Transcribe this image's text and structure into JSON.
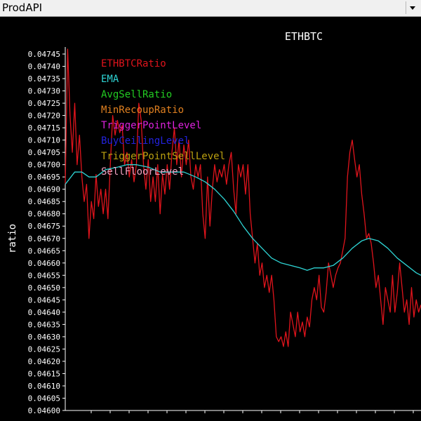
{
  "window": {
    "title": "ProdAPI"
  },
  "chart_data": {
    "type": "line",
    "title": "ETHBTC",
    "xlabel": "",
    "ylabel": "ratio",
    "ylim": [
      0.046,
      0.04745
    ],
    "y_ticks": [
      "0.04600",
      "0.04605",
      "0.04610",
      "0.04615",
      "0.04620",
      "0.04625",
      "0.04630",
      "0.04635",
      "0.04640",
      "0.04645",
      "0.04650",
      "0.04655",
      "0.04660",
      "0.04665",
      "0.04670",
      "0.04675",
      "0.04680",
      "0.04685",
      "0.04690",
      "0.04695",
      "0.04700",
      "0.04705",
      "0.04710",
      "0.04715",
      "0.04720",
      "0.04725",
      "0.04730",
      "0.04735",
      "0.04740",
      "0.04745"
    ],
    "legend_position": "top-left",
    "grid": false,
    "legend": [
      {
        "name": "ETHBTCRatio",
        "color": "#e0141c"
      },
      {
        "name": "EMA",
        "color": "#2ed4d4"
      },
      {
        "name": "AvgSellRatio",
        "color": "#22cc22"
      },
      {
        "name": "MinRecoupRatio",
        "color": "#e08020"
      },
      {
        "name": "TriggerPointLevel",
        "color": "#dd22dd"
      },
      {
        "name": "BuyCeilingLevel",
        "color": "#2222dd"
      },
      {
        "name": "TriggerPointSellLevel",
        "color": "#bba010"
      },
      {
        "name": "SellFloorLevel",
        "color": "#f0a0c0"
      }
    ],
    "series": [
      {
        "name": "ETHBTCRatio",
        "color": "#e0141c",
        "points": [
          [
            0,
            0.04692
          ],
          [
            2,
            0.04747
          ],
          [
            4,
            0.0472
          ],
          [
            6,
            0.04705
          ],
          [
            8,
            0.04725
          ],
          [
            10,
            0.047
          ],
          [
            12,
            0.04712
          ],
          [
            14,
            0.04695
          ],
          [
            16,
            0.04685
          ],
          [
            18,
            0.04692
          ],
          [
            20,
            0.0467
          ],
          [
            22,
            0.04685
          ],
          [
            24,
            0.04678
          ],
          [
            26,
            0.04696
          ],
          [
            28,
            0.04683
          ],
          [
            30,
            0.0469
          ],
          [
            32,
            0.0468
          ],
          [
            34,
            0.0469
          ],
          [
            36,
            0.04678
          ],
          [
            38,
            0.047
          ],
          [
            40,
            0.0472
          ],
          [
            42,
            0.04712
          ],
          [
            44,
            0.04718
          ],
          [
            46,
            0.04713
          ],
          [
            48,
            0.04716
          ],
          [
            50,
            0.047
          ],
          [
            52,
            0.04705
          ],
          [
            54,
            0.04695
          ],
          [
            56,
            0.04702
          ],
          [
            58,
            0.04693
          ],
          [
            60,
            0.047
          ],
          [
            62,
            0.04725
          ],
          [
            64,
            0.04718
          ],
          [
            66,
            0.047
          ],
          [
            68,
            0.0469
          ],
          [
            70,
            0.04702
          ],
          [
            72,
            0.04685
          ],
          [
            74,
            0.04695
          ],
          [
            76,
            0.04685
          ],
          [
            78,
            0.047
          ],
          [
            80,
            0.0468
          ],
          [
            82,
            0.04696
          ],
          [
            84,
            0.04688
          ],
          [
            86,
            0.047
          ],
          [
            88,
            0.0469
          ],
          [
            90,
            0.04705
          ],
          [
            92,
            0.04715
          ],
          [
            94,
            0.047
          ],
          [
            96,
            0.0471
          ],
          [
            98,
            0.04695
          ],
          [
            100,
            0.04708
          ],
          [
            102,
            0.047
          ],
          [
            104,
            0.0471
          ],
          [
            106,
            0.04695
          ],
          [
            108,
            0.0469
          ],
          [
            110,
            0.047
          ],
          [
            112,
            0.04695
          ],
          [
            114,
            0.047
          ],
          [
            116,
            0.0468
          ],
          [
            118,
            0.0467
          ],
          [
            120,
            0.04695
          ],
          [
            122,
            0.04675
          ],
          [
            124,
            0.0469
          ],
          [
            126,
            0.047
          ],
          [
            128,
            0.04693
          ],
          [
            130,
            0.04698
          ],
          [
            132,
            0.04695
          ],
          [
            134,
            0.047
          ],
          [
            136,
            0.04692
          ],
          [
            138,
            0.047
          ],
          [
            140,
            0.04705
          ],
          [
            142,
            0.0469
          ],
          [
            144,
            0.0468
          ],
          [
            146,
            0.047
          ],
          [
            148,
            0.04695
          ],
          [
            150,
            0.047
          ],
          [
            152,
            0.04688
          ],
          [
            154,
            0.047
          ],
          [
            156,
            0.0468
          ],
          [
            158,
            0.0467
          ],
          [
            160,
            0.0466
          ],
          [
            162,
            0.04668
          ],
          [
            164,
            0.04655
          ],
          [
            166,
            0.0466
          ],
          [
            168,
            0.0465
          ],
          [
            170,
            0.04655
          ],
          [
            172,
            0.04648
          ],
          [
            174,
            0.04655
          ],
          [
            176,
            0.04645
          ],
          [
            178,
            0.0463
          ],
          [
            180,
            0.04628
          ],
          [
            182,
            0.0463
          ],
          [
            184,
            0.04626
          ],
          [
            186,
            0.04632
          ],
          [
            188,
            0.04626
          ],
          [
            190,
            0.0464
          ],
          [
            192,
            0.04635
          ],
          [
            194,
            0.0463
          ],
          [
            196,
            0.0464
          ],
          [
            198,
            0.04632
          ],
          [
            200,
            0.04636
          ],
          [
            202,
            0.0463
          ],
          [
            204,
            0.04638
          ],
          [
            206,
            0.04634
          ],
          [
            208,
            0.04645
          ],
          [
            210,
            0.0465
          ],
          [
            212,
            0.04645
          ],
          [
            214,
            0.04655
          ],
          [
            216,
            0.04642
          ],
          [
            218,
            0.0464
          ],
          [
            220,
            0.04648
          ],
          [
            222,
            0.0466
          ],
          [
            224,
            0.04655
          ],
          [
            226,
            0.0465
          ],
          [
            228,
            0.04655
          ],
          [
            230,
            0.04658
          ],
          [
            232,
            0.0466
          ],
          [
            234,
            0.04665
          ],
          [
            236,
            0.0467
          ],
          [
            238,
            0.04695
          ],
          [
            240,
            0.04705
          ],
          [
            242,
            0.0471
          ],
          [
            244,
            0.04702
          ],
          [
            246,
            0.04695
          ],
          [
            248,
            0.047
          ],
          [
            250,
            0.04688
          ],
          [
            252,
            0.0468
          ],
          [
            254,
            0.0467
          ],
          [
            256,
            0.04672
          ],
          [
            258,
            0.04668
          ],
          [
            260,
            0.0466
          ],
          [
            262,
            0.0465
          ],
          [
            264,
            0.04655
          ],
          [
            266,
            0.04645
          ],
          [
            268,
            0.04635
          ],
          [
            270,
            0.0465
          ],
          [
            272,
            0.04645
          ],
          [
            274,
            0.0464
          ],
          [
            276,
            0.04655
          ],
          [
            278,
            0.0464
          ],
          [
            280,
            0.04648
          ],
          [
            282,
            0.0466
          ],
          [
            284,
            0.0465
          ],
          [
            286,
            0.0464
          ],
          [
            288,
            0.04645
          ],
          [
            290,
            0.04635
          ],
          [
            292,
            0.0465
          ],
          [
            294,
            0.04638
          ],
          [
            296,
            0.04645
          ],
          [
            298,
            0.0464
          ],
          [
            300,
            0.04643
          ]
        ]
      },
      {
        "name": "EMA",
        "color": "#2ed4d4",
        "points": [
          [
            0,
            0.04692
          ],
          [
            8,
            0.04697
          ],
          [
            14,
            0.04697
          ],
          [
            20,
            0.04695
          ],
          [
            26,
            0.04695
          ],
          [
            34,
            0.04698
          ],
          [
            44,
            0.04699
          ],
          [
            52,
            0.047
          ],
          [
            60,
            0.047
          ],
          [
            70,
            0.04699
          ],
          [
            80,
            0.04697
          ],
          [
            90,
            0.04697
          ],
          [
            100,
            0.04697
          ],
          [
            110,
            0.04695
          ],
          [
            118,
            0.04693
          ],
          [
            126,
            0.0469
          ],
          [
            134,
            0.04686
          ],
          [
            142,
            0.04681
          ],
          [
            150,
            0.04675
          ],
          [
            158,
            0.0467
          ],
          [
            166,
            0.04666
          ],
          [
            174,
            0.04662
          ],
          [
            182,
            0.0466
          ],
          [
            190,
            0.04659
          ],
          [
            198,
            0.04658
          ],
          [
            204,
            0.04657
          ],
          [
            210,
            0.04658
          ],
          [
            218,
            0.04658
          ],
          [
            226,
            0.04659
          ],
          [
            234,
            0.04662
          ],
          [
            242,
            0.04666
          ],
          [
            250,
            0.04669
          ],
          [
            256,
            0.0467
          ],
          [
            264,
            0.04669
          ],
          [
            272,
            0.04666
          ],
          [
            280,
            0.04662
          ],
          [
            288,
            0.04659
          ],
          [
            296,
            0.04656
          ],
          [
            300,
            0.04655
          ]
        ]
      }
    ]
  }
}
